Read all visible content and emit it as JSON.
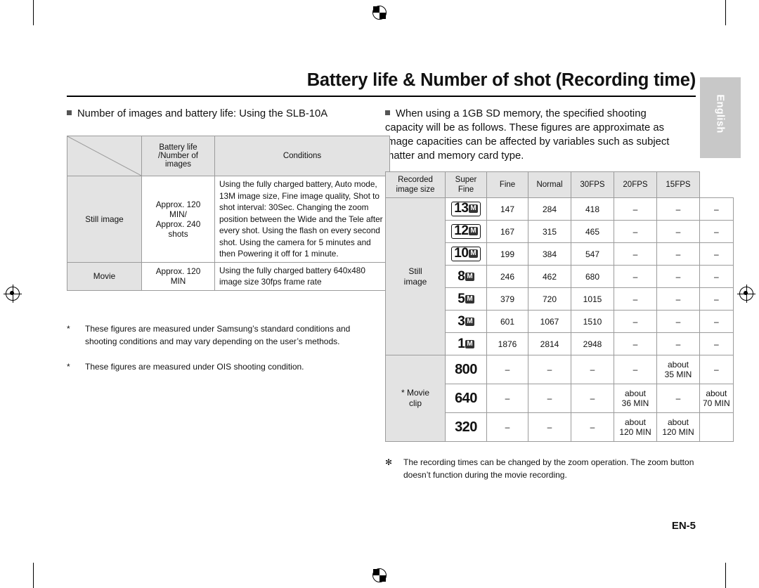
{
  "document": {
    "title": "Battery life & Number of shot (Recording time)",
    "side_tab": "English",
    "page_number": "EN-5"
  },
  "left": {
    "heading": "Number of images and battery life: Using the SLB-10A",
    "table": {
      "corner_top": "Battery life",
      "corner_mid": "/Number of",
      "corner_bottom": "images",
      "conditions_header": "Conditions",
      "rows": [
        {
          "label": "Still image",
          "value_lines": [
            "Approx. 120",
            "MIN/",
            "Approx. 240",
            "shots"
          ],
          "conditions": "Using the fully charged battery, Auto mode, 13M image size, Fine image quality, Shot to shot interval: 30Sec. Changing the zoom position between the Wide and the Tele after every shot. Using the flash on every second shot. Using the camera for 5 minutes and then Powering it off for 1 minute."
        },
        {
          "label": "Movie",
          "value_lines": [
            "Approx. 120",
            "MIN"
          ],
          "conditions": "Using the fully charged battery 640x480 image size 30fps frame rate"
        }
      ]
    },
    "footnotes": [
      "These figures are measured under Samsung’s standard conditions and shooting conditions and may vary depending on the user’s methods.",
      "These figures are measured under OIS shooting condition."
    ]
  },
  "right": {
    "heading": "When using a 1GB SD memory, the specified shooting capacity will be as follows. These figures are approximate as image capacities can be affected by variables such as subject matter and memory card type.",
    "table": {
      "headers": [
        "Recorded image size",
        "Super Fine",
        "Fine",
        "Normal",
        "30FPS",
        "20FPS",
        "15FPS"
      ],
      "group_still": "Still image",
      "group_movie": "* Movie clip",
      "still_rows": [
        {
          "size": "13",
          "unit": "M",
          "super_fine": "147",
          "fine": "284",
          "normal": "418",
          "fps30": "–",
          "fps20": "–",
          "fps15": "–"
        },
        {
          "size": "12",
          "unit": "M",
          "super_fine": "167",
          "fine": "315",
          "normal": "465",
          "fps30": "–",
          "fps20": "–",
          "fps15": "–"
        },
        {
          "size": "10",
          "unit": "M",
          "super_fine": "199",
          "fine": "384",
          "normal": "547",
          "fps30": "–",
          "fps20": "–",
          "fps15": "–"
        },
        {
          "size": "8",
          "unit": "M",
          "super_fine": "246",
          "fine": "462",
          "normal": "680",
          "fps30": "–",
          "fps20": "–",
          "fps15": "–"
        },
        {
          "size": "5",
          "unit": "M",
          "super_fine": "379",
          "fine": "720",
          "normal": "1015",
          "fps30": "–",
          "fps20": "–",
          "fps15": "–"
        },
        {
          "size": "3",
          "unit": "M",
          "super_fine": "601",
          "fine": "1067",
          "normal": "1510",
          "fps30": "–",
          "fps20": "–",
          "fps15": "–"
        },
        {
          "size": "1",
          "unit": "M",
          "super_fine": "1876",
          "fine": "2814",
          "normal": "2948",
          "fps30": "–",
          "fps20": "–",
          "fps15": "–"
        }
      ],
      "movie_rows": [
        {
          "size": "800",
          "super_fine": "–",
          "fine": "–",
          "normal": "–",
          "fps30": "–",
          "fps20": "about 35 MIN",
          "fps15": "–"
        },
        {
          "size": "640",
          "super_fine": "–",
          "fine": "–",
          "normal": "–",
          "fps30": "about 36 MIN",
          "fps20": "–",
          "fps15": "about 70 MIN"
        },
        {
          "size": "320",
          "super_fine": "–",
          "fine": "–",
          "normal": "–",
          "fps30": "–",
          "fps20": "about 120 MIN",
          "fps15": "about 120 MIN"
        }
      ]
    },
    "footnote": "The recording times can be changed by the zoom operation. The zoom button doesn’t function during the movie recording."
  }
}
